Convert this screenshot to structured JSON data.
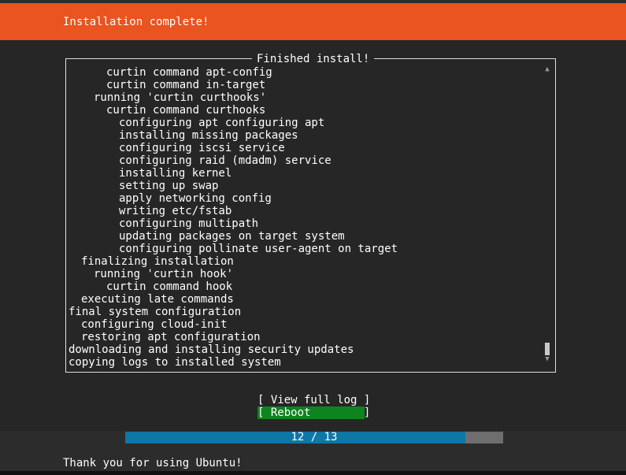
{
  "header": {
    "title": "Installation complete!",
    "color": "#e95420"
  },
  "log_panel": {
    "title": "Finished install!",
    "lines": [
      {
        "indent": 3,
        "text": "curtin command apt-config"
      },
      {
        "indent": 3,
        "text": "curtin command in-target"
      },
      {
        "indent": 2,
        "text": "running 'curtin curthooks'"
      },
      {
        "indent": 3,
        "text": "curtin command curthooks"
      },
      {
        "indent": 4,
        "text": "configuring apt configuring apt"
      },
      {
        "indent": 4,
        "text": "installing missing packages"
      },
      {
        "indent": 4,
        "text": "configuring iscsi service"
      },
      {
        "indent": 4,
        "text": "configuring raid (mdadm) service"
      },
      {
        "indent": 4,
        "text": "installing kernel"
      },
      {
        "indent": 4,
        "text": "setting up swap"
      },
      {
        "indent": 4,
        "text": "apply networking config"
      },
      {
        "indent": 4,
        "text": "writing etc/fstab"
      },
      {
        "indent": 4,
        "text": "configuring multipath"
      },
      {
        "indent": 4,
        "text": "updating packages on target system"
      },
      {
        "indent": 4,
        "text": "configuring pollinate user-agent on target"
      },
      {
        "indent": 1,
        "text": "finalizing installation"
      },
      {
        "indent": 2,
        "text": "running 'curtin hook'"
      },
      {
        "indent": 3,
        "text": "curtin command hook"
      },
      {
        "indent": 1,
        "text": "executing late commands"
      },
      {
        "indent": 0,
        "text": "final system configuration"
      },
      {
        "indent": 1,
        "text": "configuring cloud-init"
      },
      {
        "indent": 1,
        "text": "restoring apt configuration"
      },
      {
        "indent": 0,
        "text": "downloading and installing security updates"
      },
      {
        "indent": 0,
        "text": "copying logs to installed system"
      }
    ],
    "scroll_up_icon": "up-arrow-icon",
    "scroll_down_icon": "down-arrow-icon"
  },
  "buttons": {
    "view_full_log": "[ View full log ]",
    "reboot": "[ Reboot        ]",
    "reboot_color": "#0e8420"
  },
  "progress": {
    "current": 12,
    "total": 13,
    "label": "12 / 13",
    "fraction": 0.9,
    "fill_color": "#0e77a6"
  },
  "footer": {
    "text": "Thank you for using Ubuntu!"
  }
}
